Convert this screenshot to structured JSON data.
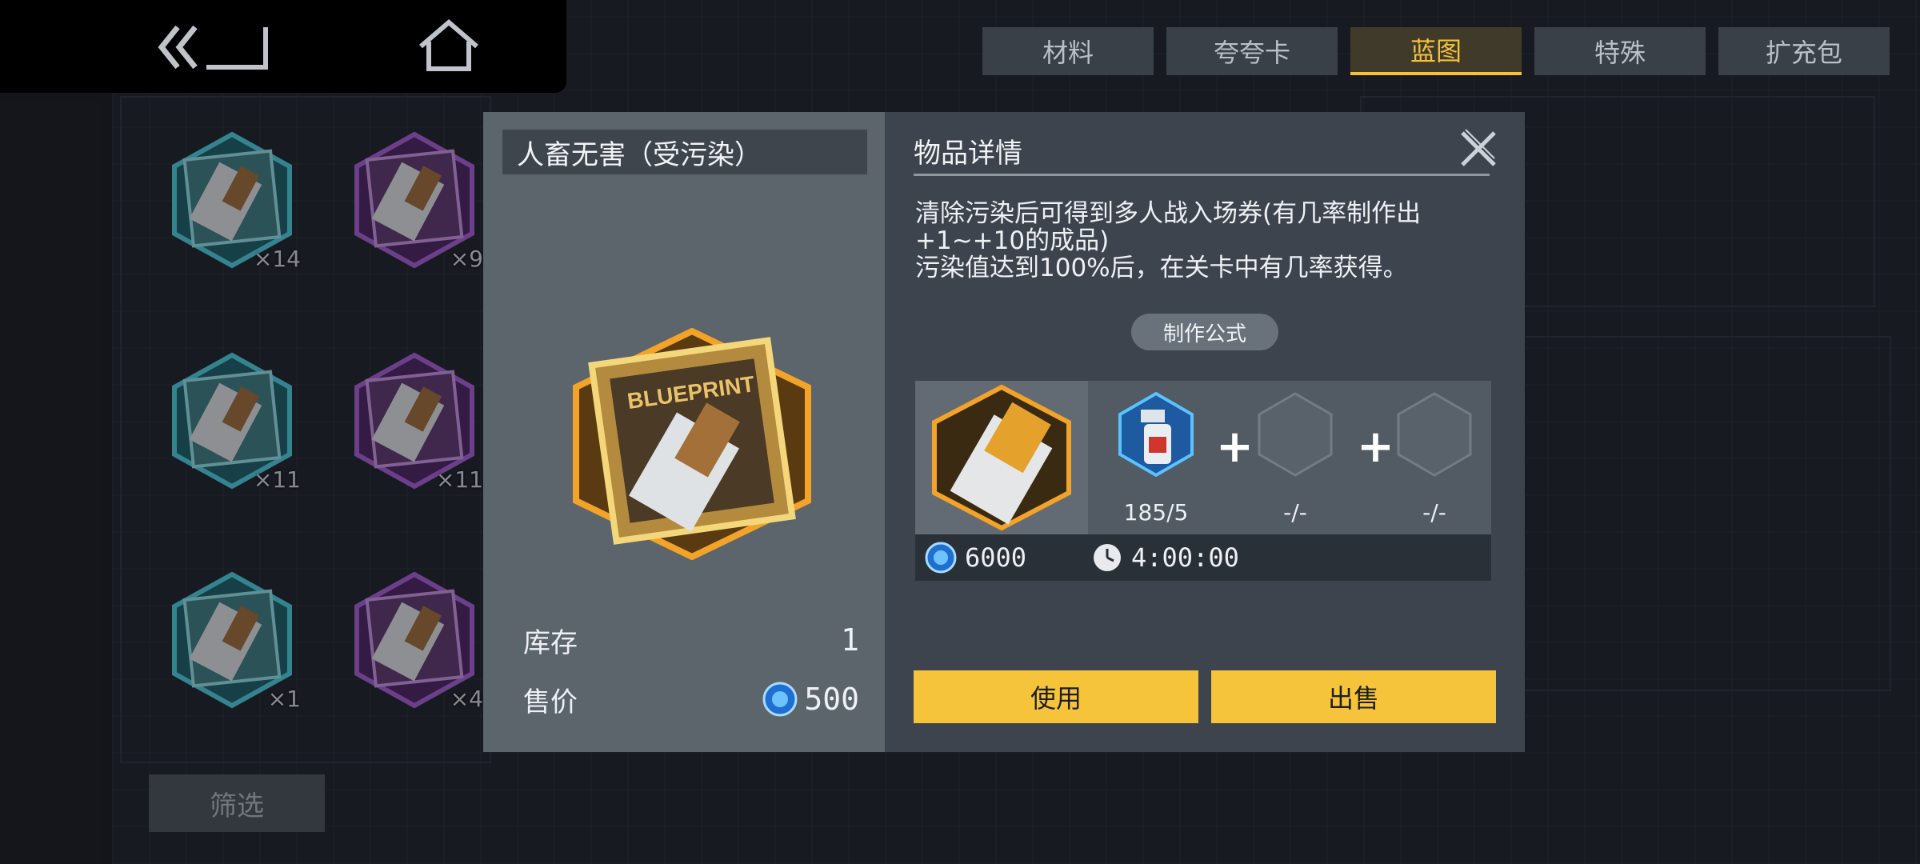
{
  "tabs": [
    {
      "label": "材料"
    },
    {
      "label": "夸夸卡"
    },
    {
      "label": "蓝图",
      "active": true
    },
    {
      "label": "特殊"
    },
    {
      "label": "扩充包"
    }
  ],
  "inventory": [
    {
      "count": "×14",
      "color": "teal"
    },
    {
      "count": "×9",
      "color": "purple"
    },
    {
      "count": "×11",
      "color": "teal"
    },
    {
      "count": "×11",
      "color": "purple"
    },
    {
      "count": "×1",
      "color": "teal"
    },
    {
      "count": "×4",
      "color": "purple"
    }
  ],
  "filter_label": "筛选",
  "item": {
    "name": "人畜无害（受污染）",
    "stock_label": "库存",
    "stock_value": "1",
    "price_label": "售价",
    "price_value": "500",
    "icon_text": "BLUEPRINT"
  },
  "detail": {
    "title": "物品详情",
    "desc_lines": [
      "清除污染后可得到多人战入场券(有几率制作出",
      "+1~+10的成品)",
      "污染值达到100%后，在关卡中有几率获得。"
    ],
    "formula_label": "制作公式",
    "ingredients": [
      {
        "count": "185/5",
        "icon": "spray-bottle-icon"
      },
      {
        "count": "-/-",
        "icon": "empty-slot-icon"
      },
      {
        "count": "-/-",
        "icon": "empty-slot-icon"
      }
    ],
    "cost": "6000",
    "time": "4:00:00",
    "use_label": "使用",
    "sell_label": "出售"
  },
  "colors": {
    "accent": "#f6c43a",
    "teal": "#3a8f96",
    "purple": "#7b3fa0",
    "gold": "#e8a522"
  }
}
